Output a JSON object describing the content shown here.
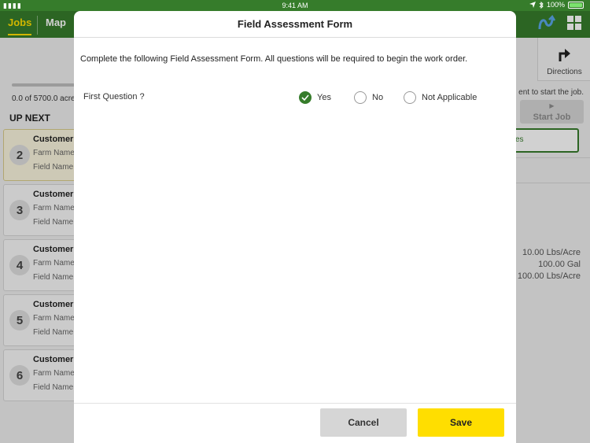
{
  "status_bar": {
    "time": "9:41 AM",
    "battery": "100%"
  },
  "nav": {
    "tabs": [
      {
        "label": "Jobs",
        "active": true
      },
      {
        "label": "Map",
        "active": false
      }
    ]
  },
  "current_job": {
    "acres_text": "0.0 of 5700.0 acre"
  },
  "up_next": {
    "heading": "UP NEXT",
    "jobs": [
      {
        "number": "2",
        "customer": "Customer",
        "farm": "Farm Name",
        "field": "Field Name"
      },
      {
        "number": "3",
        "customer": "Customer",
        "farm": "Farm Name",
        "field": "Field Name"
      },
      {
        "number": "4",
        "customer": "Customer",
        "farm": "Farm Name",
        "field": "Field Name"
      },
      {
        "number": "5",
        "customer": "Customer",
        "farm": "Farm Name",
        "field": "Field Name"
      },
      {
        "number": "6",
        "customer": "Customer",
        "farm": "Farm Name",
        "field": "Field Name"
      }
    ]
  },
  "right_panel": {
    "directions_label": "Directions",
    "start_hint": "ent to start the job.",
    "start_job_label": "Start Job",
    "outlined_button_label": "es",
    "rates": [
      "10.00 Lbs/Acre",
      "100.00 Gal",
      "100.00 Lbs/Acre"
    ]
  },
  "modal": {
    "title": "Field Assessment Form",
    "instructions": "Complete the following Field Assessment Form. All questions will be required to begin the work order.",
    "questions": [
      {
        "label": "First Question ?",
        "options": [
          {
            "label": "Yes",
            "selected": true
          },
          {
            "label": "No",
            "selected": false
          },
          {
            "label": "Not Applicable",
            "selected": false
          }
        ]
      }
    ],
    "cancel_label": "Cancel",
    "save_label": "Save"
  },
  "colors": {
    "brand_green": "#367c2b",
    "accent_yellow": "#ffde00"
  }
}
